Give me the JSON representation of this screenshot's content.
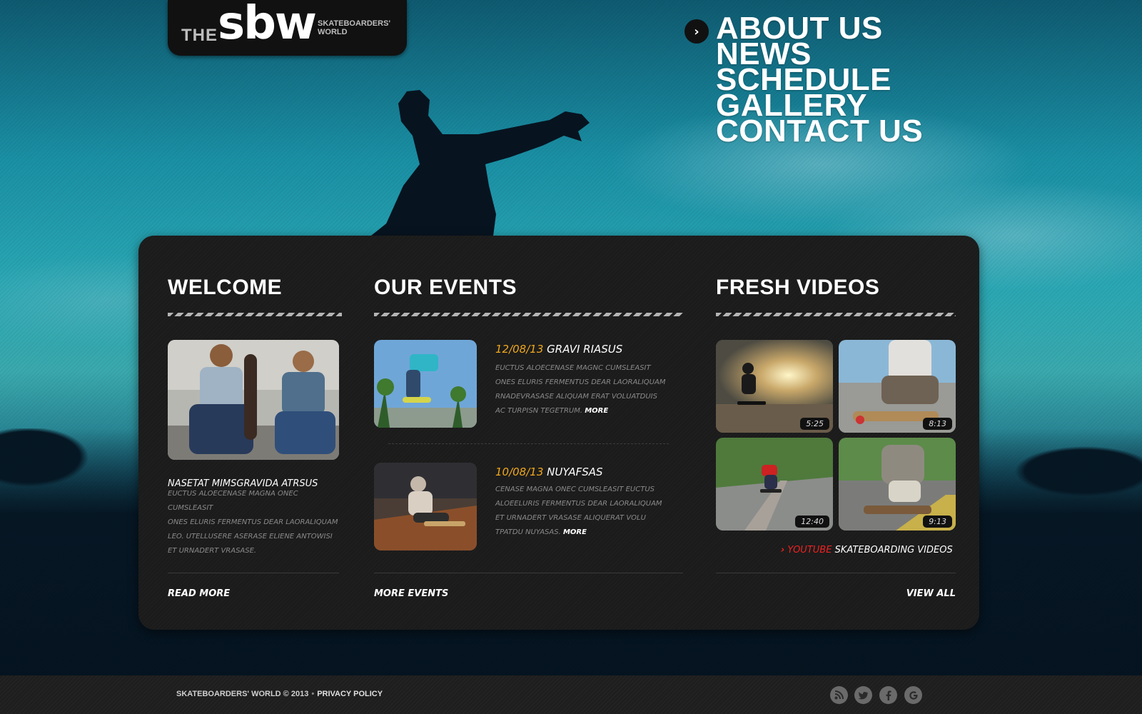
{
  "logo": {
    "the": "THE",
    "sbw": "sbw",
    "tagline_line1": "SKATEBOARDERS'",
    "tagline_line2": "WORLD"
  },
  "nav": {
    "items": [
      "ABOUT US",
      "NEWS",
      "SCHEDULE",
      "GALLERY",
      "CONTACT US"
    ]
  },
  "welcome": {
    "title": "WELCOME",
    "heading": "NASETAT MIMSGRAVIDA ATRSUS",
    "text_lines": [
      "EUCTUS ALOECENASE MAGNA ONEC CUMSLEASIT",
      "ONES ELURIS FERMENTUS DEAR LAORALIQUAM",
      "LEO. UTELLUSERE ASERASE ELIENE ANTOWISI",
      "ET URNADERT VRASASE."
    ],
    "read_more": "READ MORE"
  },
  "events": {
    "title": "OUR EVENTS",
    "items": [
      {
        "date": "12/08/13",
        "name": "GRAVI RIASUS",
        "text_lines": [
          "EUCTUS ALOECENASE MAGNC CUMSLEASIT",
          "ONES ELURIS FERMENTUS DEAR LAORALIQUAM",
          "RNADEVRASASE ALIQUAM ERAT VOLUATDUIS",
          "AC TURPISN TEGETRUM."
        ],
        "more": "MORE"
      },
      {
        "date": "10/08/13",
        "name": "NUYAFSAS",
        "text_lines": [
          "CENASE MAGNA ONEC CUMSLEASIT EUCTUS",
          "ALOEELURIS FERMENTUS DEAR LAORALIQUAM",
          "ET URNADERT VRASASE ALIQUERAT VOLU",
          "TPATDU NUYASAS."
        ],
        "more": "MORE"
      }
    ],
    "more_events": "MORE EVENTS"
  },
  "videos": {
    "title": "FRESH VIDEOS",
    "durations": [
      "5:25",
      "8:13",
      "12:40",
      "9:13"
    ],
    "youtube_arrow": "›",
    "youtube_word": "YOUTUBE",
    "youtube_rest": "SKATEBOARDING VIDEOS",
    "view_all": "VIEW ALL"
  },
  "footer": {
    "copyright": "SKATEBOARDERS' WORLD © 2013",
    "separator": "•",
    "privacy": "PRIVACY POLICY",
    "social": [
      "rss-icon",
      "twitter-icon",
      "facebook-icon",
      "google-icon"
    ]
  },
  "colors": {
    "accent_orange": "#f0a81e",
    "youtube_red": "#ee2222",
    "panel": "#1b1b1b"
  }
}
